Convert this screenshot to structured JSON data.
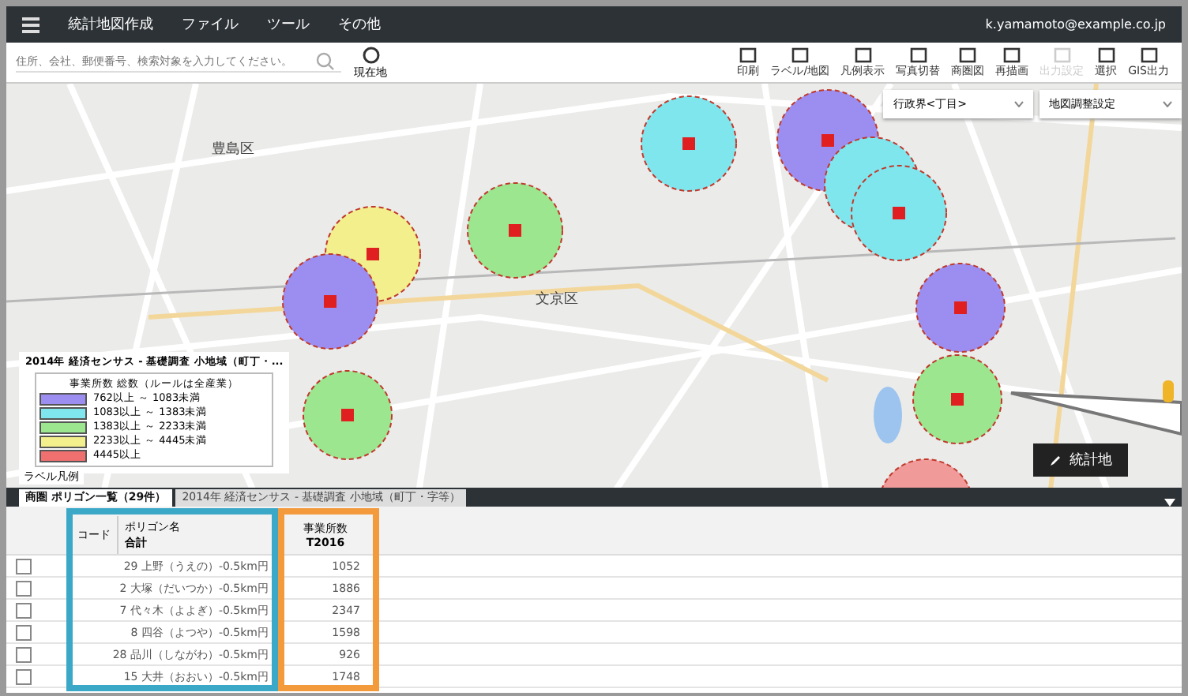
{
  "menu_bar": {
    "items": [
      "統計地図作成",
      "ファイル",
      "ツール",
      "その他"
    ],
    "user": "k.yamamoto@example.co.jp"
  },
  "search": {
    "placeholder": "住所、会社、郵便番号、検索対象を入力してください。",
    "location_button": "現在地"
  },
  "toolbar": {
    "buttons": [
      {
        "label": "印刷",
        "disabled": false
      },
      {
        "label": "ラベル/地図",
        "disabled": false
      },
      {
        "label": "凡例表示",
        "disabled": false
      },
      {
        "label": "写真切替",
        "disabled": false
      },
      {
        "label": "商圏図",
        "disabled": false
      },
      {
        "label": "再描画",
        "disabled": false
      },
      {
        "label": "出力設定",
        "disabled": true
      },
      {
        "label": "選択",
        "disabled": false
      },
      {
        "label": "GIS出力",
        "disabled": false
      }
    ]
  },
  "map": {
    "dropdowns": [
      "行政界<丁目>",
      "地図調整設定"
    ],
    "place_labels": [
      "豊島区",
      "文京区"
    ],
    "circles": [
      {
        "color": "#7fe6ee"
      },
      {
        "color": "#9c8ef0"
      },
      {
        "color": "#7fe6ee"
      },
      {
        "color": "#7fe6ee"
      },
      {
        "color": "#9be68f"
      },
      {
        "color": "#f2ef8c"
      },
      {
        "color": "#9c8ef0"
      },
      {
        "color": "#9c8ef0"
      },
      {
        "color": "#9be68f"
      },
      {
        "color": "#9be68f"
      },
      {
        "color": "#f09a9a"
      }
    ],
    "legend": {
      "title": "2014年 経済センサス - 基礎調査 小地域（町丁・...",
      "header": "事業所数 総数（ルールは全産業）",
      "items": [
        {
          "label": "762以上 ～ 1083未満",
          "color": "#9c8ef0"
        },
        {
          "label": "1083以上 ～ 1383未満",
          "color": "#7fe6ee"
        },
        {
          "label": "1383以上 ～ 2233未満",
          "color": "#9be68f"
        },
        {
          "label": "2233以上 ～ 4445未満",
          "color": "#f2ef8c"
        },
        {
          "label": "4445以上",
          "color": "#f07070"
        }
      ]
    },
    "legend_toggle": "ラベル凡例",
    "edit_button": "統計地"
  },
  "panel": {
    "tabs": [
      {
        "label": "商圏 ポリゴン一覧（29件）",
        "selected": true
      },
      {
        "label": "2014年 経済センサス - 基礎調査 小地域（町丁・字等）",
        "selected": false
      }
    ],
    "columns": [
      {
        "top": "コード"
      },
      {
        "top": "ポリゴン名",
        "bottom": "合計"
      },
      {
        "top": "事業所数",
        "bottom": "T2016"
      }
    ],
    "rows": [
      {
        "checked": false,
        "code": "29",
        "name": "上野（うえの）-0.5km円",
        "value": "1052"
      },
      {
        "checked": false,
        "code": "2",
        "name": "大塚（だいつか）-0.5km円",
        "value": "1886"
      },
      {
        "checked": false,
        "code": "7",
        "name": "代々木（よよぎ）-0.5km円",
        "value": "2347"
      },
      {
        "checked": false,
        "code": "8",
        "name": "四谷（よつや）-0.5km円",
        "value": "1598"
      },
      {
        "checked": false,
        "code": "28",
        "name": "品川（しながわ）-0.5km円",
        "value": "926"
      },
      {
        "checked": false,
        "code": "15",
        "name": "大井（おおい）-0.5km円",
        "value": "1748"
      }
    ]
  }
}
